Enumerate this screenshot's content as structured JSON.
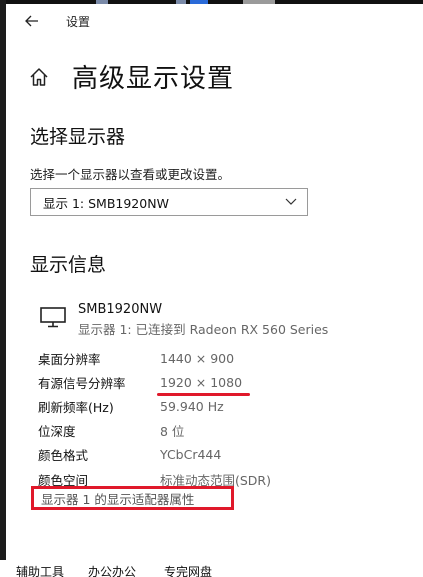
{
  "window": {
    "title": "设置"
  },
  "header": {
    "title": "高级显示设置"
  },
  "choose_display": {
    "heading": "选择显示器",
    "description": "选择一个显示器以查看或更改设置。",
    "selected": "显示 1: SMB1920NW"
  },
  "display_info": {
    "heading": "显示信息",
    "monitor_name": "SMB1920NW",
    "monitor_sub": "显示器 1: 已连接到 Radeon RX 560 Series",
    "rows": [
      {
        "label": "桌面分辨率",
        "value": "1440 × 900"
      },
      {
        "label": "有源信号分辨率",
        "value": "1920 × 1080"
      },
      {
        "label": "刷新频率(Hz)",
        "value": "59.940 Hz"
      },
      {
        "label": "位深度",
        "value": "8 位"
      },
      {
        "label": "颜色格式",
        "value": "YCbCr444"
      },
      {
        "label": "颜色空间",
        "value": "标准动态范围(SDR)"
      }
    ],
    "adapter_link": "显示器 1 的显示适配器属性"
  },
  "taskbar": {
    "items": [
      "辅助工具",
      "办公办公",
      "专完网盘"
    ]
  },
  "colors": {
    "annotation_red": "#e0182a",
    "secondary_text": "#666666"
  }
}
